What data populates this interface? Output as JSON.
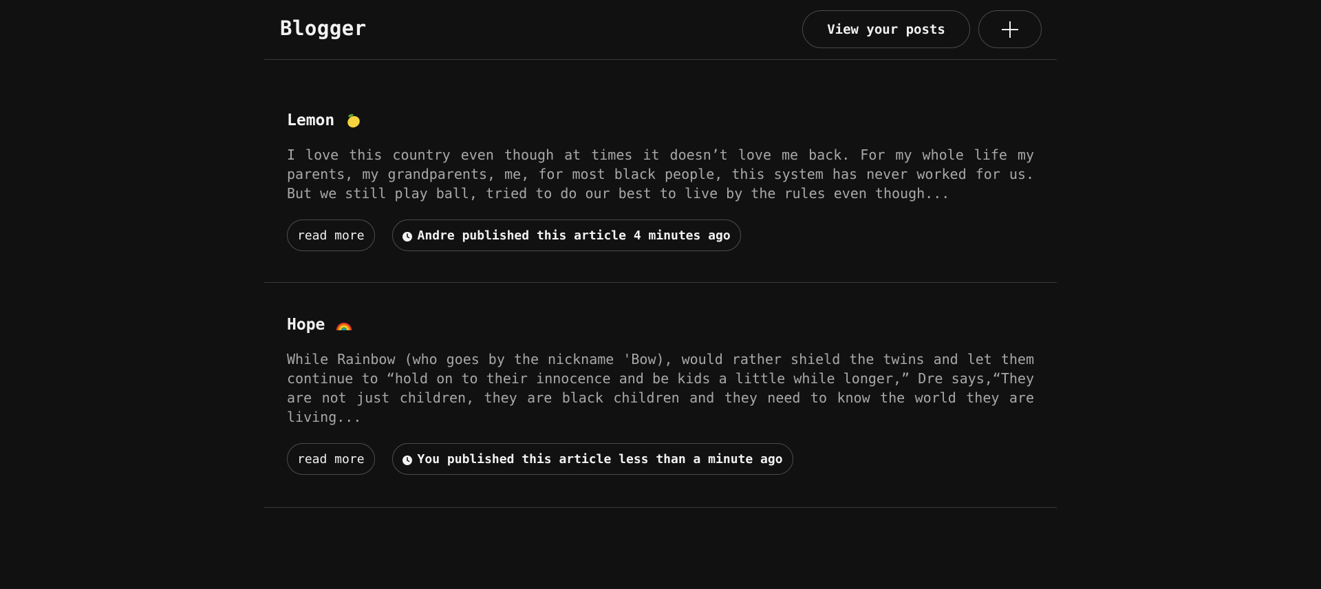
{
  "header": {
    "brand": "Blogger",
    "view_posts_label": "View your posts",
    "add_icon": "plus-icon"
  },
  "posts": [
    {
      "title": "Lemon",
      "emoji": "lemon-icon",
      "excerpt": "I love this country even though at times it doesn’t love me back. For my whole life my parents, my grandparents, me, for most black people, this system has never worked for us. But we still play ball, tried to do our best to live by the rules even though...",
      "read_more_label": "read more",
      "meta": "Andre published this article 4 minutes ago",
      "meta_icon": "clock-icon"
    },
    {
      "title": "Hope",
      "emoji": "rainbow-icon",
      "excerpt": "While Rainbow (who goes by the nickname 'Bow), would rather shield the twins and let them continue to “hold on to their innocence and be kids a little while longer,” Dre says,“They are not just children, they are black children and they need to know the world they are living...",
      "read_more_label": "read more",
      "meta": "You published this article less than a minute ago",
      "meta_icon": "clock-icon"
    }
  ],
  "colors": {
    "background": "#111111",
    "text": "#f2f2f2",
    "muted_text": "#a8a8a8",
    "border": "#4a4a4a",
    "lemon": "#f7d340",
    "lemon_leaf": "#5aa02c"
  }
}
